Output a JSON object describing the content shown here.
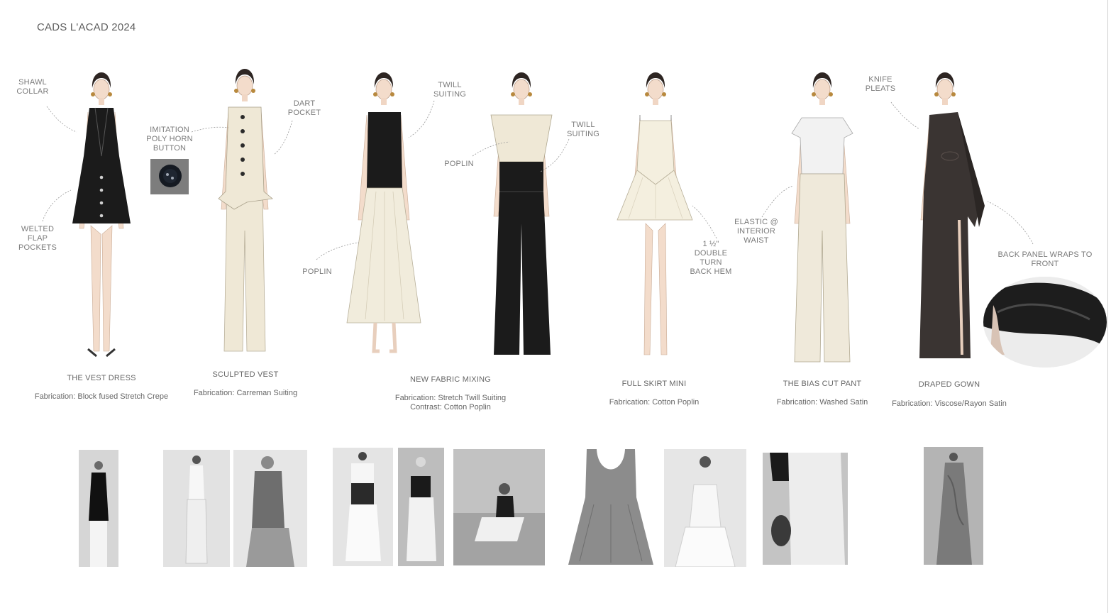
{
  "page": {
    "title": "CADS L'ACAD 2024"
  },
  "colors": {
    "black": "#1b1b1b",
    "ivory": "#f1ecdc",
    "cream": "#efe8d6",
    "skin": "#f3dccb",
    "gown": "#3a3432",
    "photo_gray": "#8c8c8c"
  },
  "callouts": {
    "shawl_collar": "SHAWL\nCOLLAR",
    "welted_flap_pockets": "WELTED\nFLAP\nPOCKETS",
    "imitation_button": "IMITATION\nPOLY HORN\nBUTTON",
    "dart_pocket": "DART\nPOCKET",
    "twill_suiting_1": "TWILL\nSUITING",
    "poplin_1": "POPLIN",
    "poplin_2": "POPLIN",
    "twill_suiting_2": "TWILL\nSUITING",
    "double_turn_hem": "1 ½\"\nDOUBLE\nTURN\nBACK HEM",
    "elastic_waist": "ELASTIC @\nINTERIOR\nWAIST",
    "knife_pleats": "KNIFE\nPLEATS",
    "back_panel": "BACK PANEL WRAPS TO\nFRONT"
  },
  "looks": [
    {
      "title": "THE VEST DRESS",
      "fabrication": "Fabrication:  Block fused Stretch Crepe"
    },
    {
      "title": "SCULPTED VEST",
      "fabrication": "Fabrication:  Carreman Suiting"
    },
    {
      "title": "NEW FABRIC MIXING",
      "fabrication": "Fabrication:  Stretch Twill Suiting\nContrast: Cotton Poplin"
    },
    {
      "title": "FULL SKIRT MINI",
      "fabrication": "Fabrication:  Cotton Poplin"
    },
    {
      "title": "THE BIAS CUT PANT",
      "fabrication": "Fabrication:  Washed Satin"
    },
    {
      "title": "DRAPED GOWN",
      "fabrication": "Fabrication:  Viscose/Rayon Satin"
    }
  ]
}
